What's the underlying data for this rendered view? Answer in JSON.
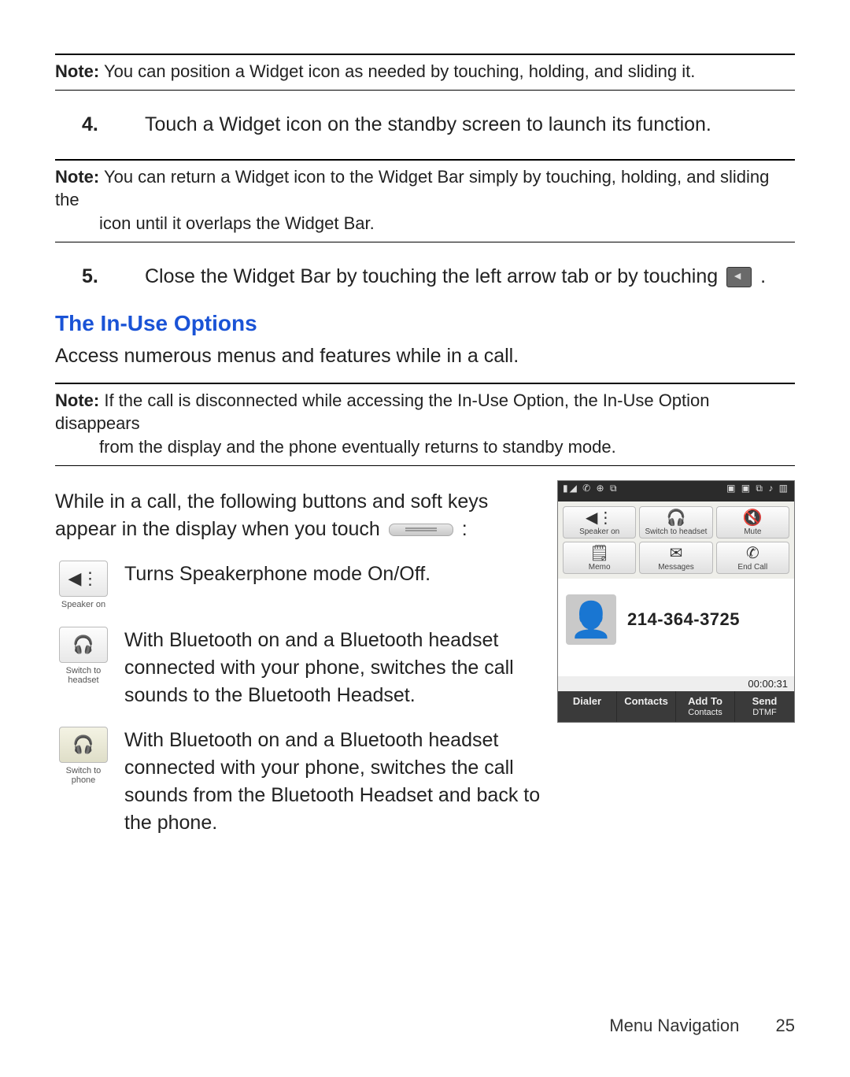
{
  "notes": {
    "n1_label": "Note:",
    "n1_text": "You can position a Widget icon as needed by touching, holding, and sliding it.",
    "n2_label": "Note:",
    "n2_text_a": "You can return a Widget icon to the Widget Bar simply by touching, holding, and sliding the",
    "n2_text_b": "icon until it overlaps the Widget Bar.",
    "n3_label": "Note:",
    "n3_text_a": "If the call is disconnected while accessing the In-Use Option, the In-Use Option disappears",
    "n3_text_b": "from the display and the phone eventually returns to standby mode."
  },
  "steps": {
    "s4_num": "4.",
    "s4_text": "Touch a Widget icon on the standby screen to launch its function.",
    "s5_num": "5.",
    "s5_text_a": "Close the Widget Bar by touching the left arrow tab or by touching ",
    "s5_text_b": " ."
  },
  "section_title": "The In-Use Options",
  "section_intro": "Access numerous menus and features while in a call.",
  "lead_a": "While in a call, the following buttons and soft keys",
  "lead_b": "appear in the display when you touch ",
  "lead_c": " :",
  "icons": {
    "speaker_cap": "Speaker on",
    "speaker_desc": "Turns Speakerphone mode On/Off.",
    "switch_headset_cap": "Switch to headset",
    "switch_headset_desc": "With Bluetooth on and a Bluetooth headset connected with your phone, switches the call sounds to the Bluetooth Headset.",
    "switch_phone_cap": "Switch to phone",
    "switch_phone_desc": "With Bluetooth on and a Bluetooth headset connected with your phone, switches the call sounds from the Bluetooth Headset and back to the phone."
  },
  "phone": {
    "status_left": "▮◢ ✆ ⊕ ⧉",
    "status_right": "▣ ▣ ⧉ ♪ ▥",
    "btn_speaker": "Speaker on",
    "btn_switch": "Switch to headset",
    "btn_mute": "Mute",
    "btn_memo": "Memo",
    "btn_messages": "Messages",
    "btn_endcall": "End Call",
    "number": "214-364-3725",
    "timer": "00:00:31",
    "bottom": {
      "dialer": "Dialer",
      "contacts": "Contacts",
      "addto_a": "Add To",
      "addto_b": "Contacts",
      "send_a": "Send",
      "send_b": "DTMF"
    }
  },
  "footer": {
    "section": "Menu Navigation",
    "page": "25"
  }
}
